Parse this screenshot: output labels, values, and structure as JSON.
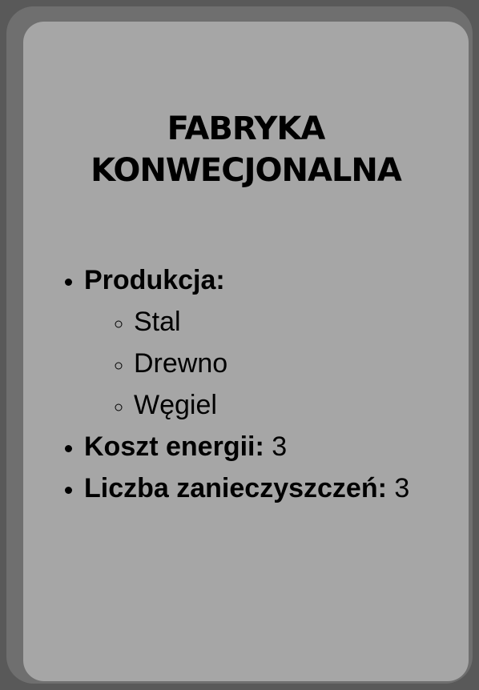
{
  "card": {
    "title_line1": "FABRYKA",
    "title_line2": "KONWECJONALNA",
    "production": {
      "label": "Produkcja:",
      "items": [
        "Stal",
        "Drewno",
        "Węgiel"
      ]
    },
    "energy_cost": {
      "label": "Koszt energii:",
      "value": "3"
    },
    "pollution": {
      "label": "Liczba zanieczyszczeń:",
      "value": "3"
    }
  },
  "colors": {
    "background": "#595959",
    "border": "#6f6f6f",
    "card": "#a6a6a6",
    "text": "#000000"
  }
}
